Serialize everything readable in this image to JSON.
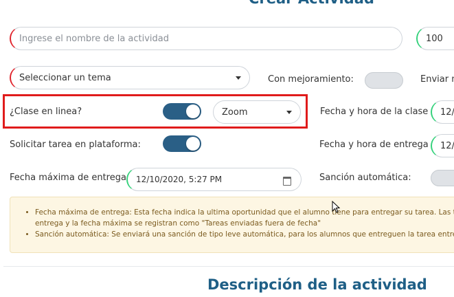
{
  "header": {
    "title": "Crear Actividad"
  },
  "form": {
    "activity_name": {
      "placeholder": "Ingrese el nombre de la actividad"
    },
    "score": {
      "value": "100"
    },
    "topic_select": {
      "value": "Seleccionar un tema"
    },
    "with_improvement": {
      "label": "Con mejoramiento:",
      "state": "off"
    },
    "send_partial": {
      "label": "Enviar m"
    },
    "online_class": {
      "label": "¿Clase en linea?",
      "state": "on"
    },
    "platform_select": {
      "value": "Zoom"
    },
    "class_datetime": {
      "label": "Fecha y hora de la clase",
      "value": "12/"
    },
    "request_task": {
      "label": "Solicitar tarea en plataforma:",
      "state": "on"
    },
    "delivery_datetime": {
      "label": "Fecha y hora de entrega",
      "value": "12/"
    },
    "max_delivery_date": {
      "label": "Fecha máxima de entrega",
      "value": "12/10/2020, 5:27 PM"
    },
    "auto_sanction": {
      "label": "Sanción automática:",
      "state": "off"
    }
  },
  "notice": {
    "line1": "Fecha máxima de entrega: Esta fecha indica la ultima oportunidad que el alumno tiene para entregar su tarea. Las t",
    "line1b": "entrega y la fecha máxima se registran como \"Tareas enviadas fuera de fecha\"",
    "line2": "Sanción automática: Se enviará una sanción de tipo leve automática, para los alumnos que entreguen la tarea entre"
  },
  "section": {
    "title": "Descripción de la actividad"
  },
  "colors": {
    "accent": "#2a5f86",
    "required": "#e0222a",
    "valid": "#34d17b",
    "highlight": "#e01b1b"
  }
}
